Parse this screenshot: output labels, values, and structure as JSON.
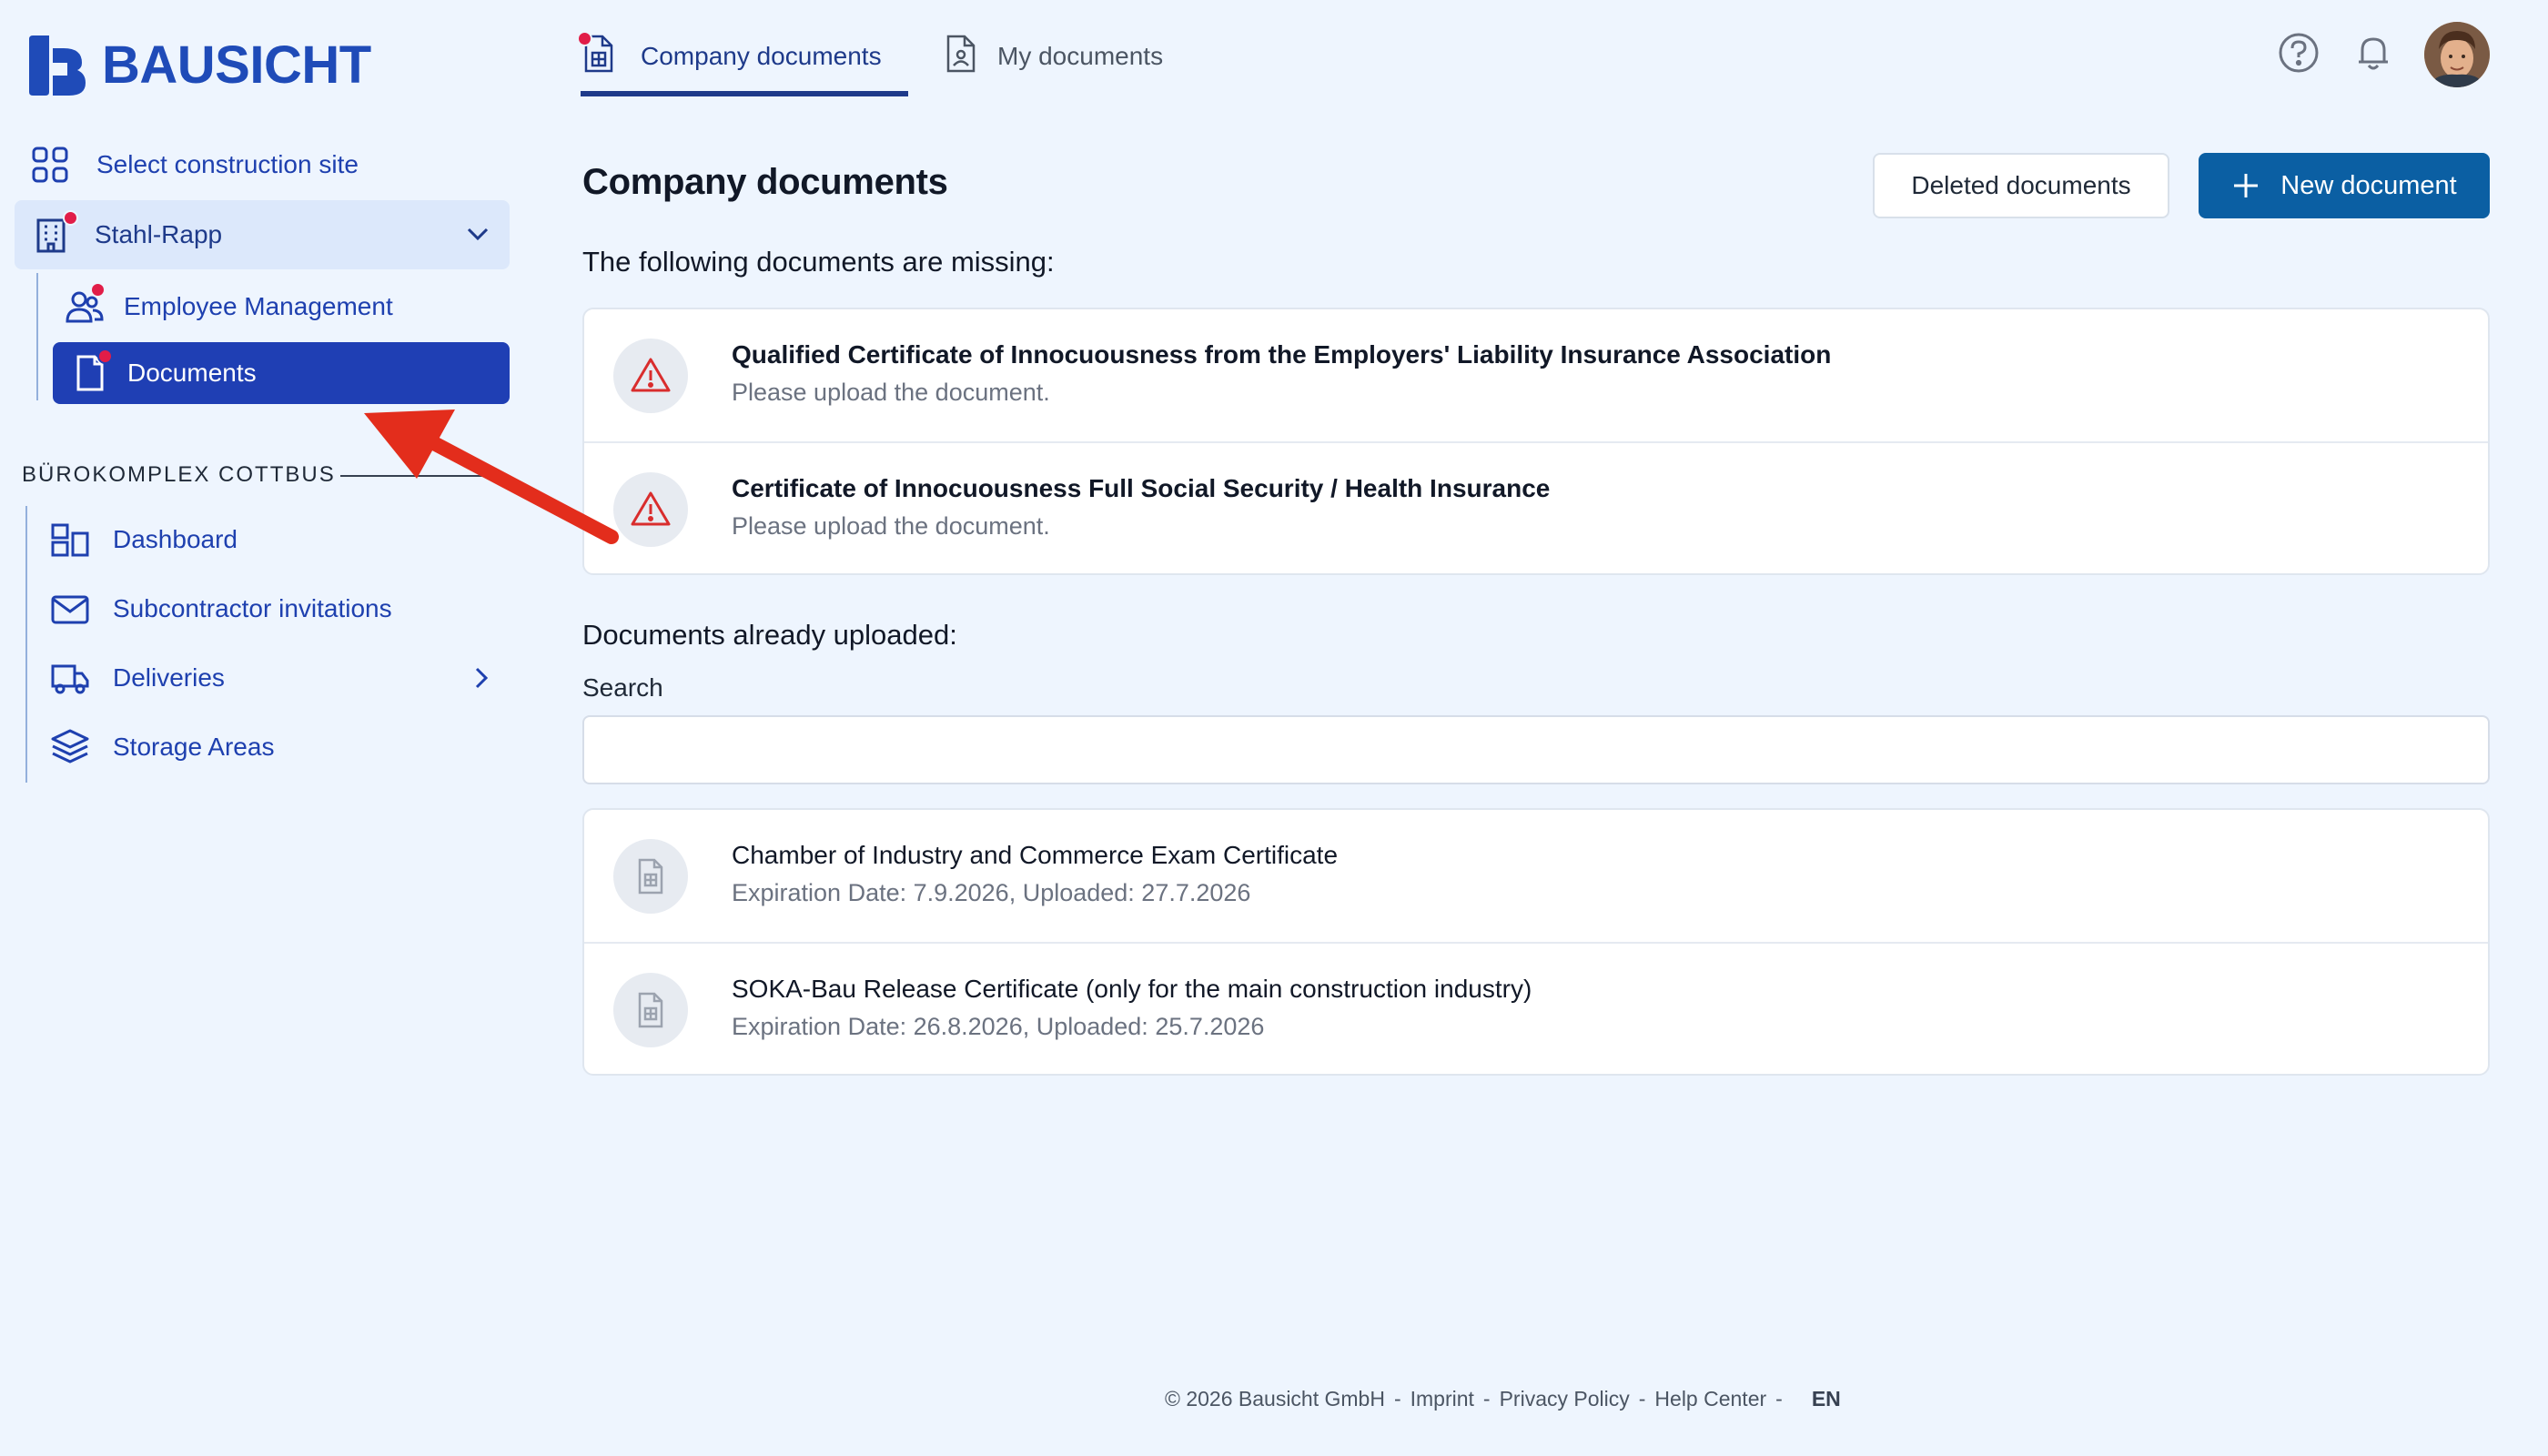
{
  "brand": {
    "name": "BAUSICHT"
  },
  "sidebar": {
    "select_site": "Select construction site",
    "company": "Stahl-Rapp",
    "employee_management": "Employee Management",
    "documents": "Documents",
    "section_label": "BÜROKOMPLEX COTTBUS",
    "items": [
      {
        "label": "Dashboard"
      },
      {
        "label": "Subcontractor invitations"
      },
      {
        "label": "Deliveries"
      },
      {
        "label": "Storage Areas"
      }
    ]
  },
  "tabs": [
    {
      "label": "Company documents",
      "active": true
    },
    {
      "label": "My documents",
      "active": false
    }
  ],
  "main": {
    "title": "Company documents",
    "deleted_button": "Deleted documents",
    "new_button": "New document",
    "missing_heading": "The following documents are missing:",
    "missing": [
      {
        "title": "Qualified Certificate of Innocuousness from the Employers' Liability Insurance Association",
        "note": "Please upload the document."
      },
      {
        "title": "Certificate of Innocuousness Full Social Security / Health Insurance",
        "note": "Please upload the document."
      }
    ],
    "uploaded_heading": "Documents already uploaded:",
    "search_label": "Search",
    "search_value": "",
    "uploaded": [
      {
        "title": "Chamber of Industry and Commerce Exam Certificate",
        "meta": "Expiration Date: 7.9.2026, Uploaded: 27.7.2026"
      },
      {
        "title": "SOKA-Bau Release Certificate (only for the main construction industry)",
        "meta": "Expiration Date: 26.8.2026, Uploaded: 25.7.2026"
      }
    ]
  },
  "footer": {
    "copyright": "© 2026 Bausicht GmbH",
    "separator": "-",
    "links": [
      "Imprint",
      "Privacy Policy",
      "Help Center"
    ],
    "language": "EN"
  },
  "colors": {
    "primary": "#1f3fb4",
    "button": "#0b5fa3",
    "alert": "#e11d48",
    "background": "#eef5fe",
    "annotation_arrow": "#e32d1c"
  },
  "icons": {
    "select_site": "grid-icon",
    "company": "building-icon",
    "employees": "users-icon",
    "documents": "document-icon",
    "dashboard": "dashboard-icon",
    "invitations": "envelope-icon",
    "deliveries": "truck-icon",
    "storage": "layers-icon",
    "missing": "warning-icon",
    "uploaded": "file-icon"
  }
}
